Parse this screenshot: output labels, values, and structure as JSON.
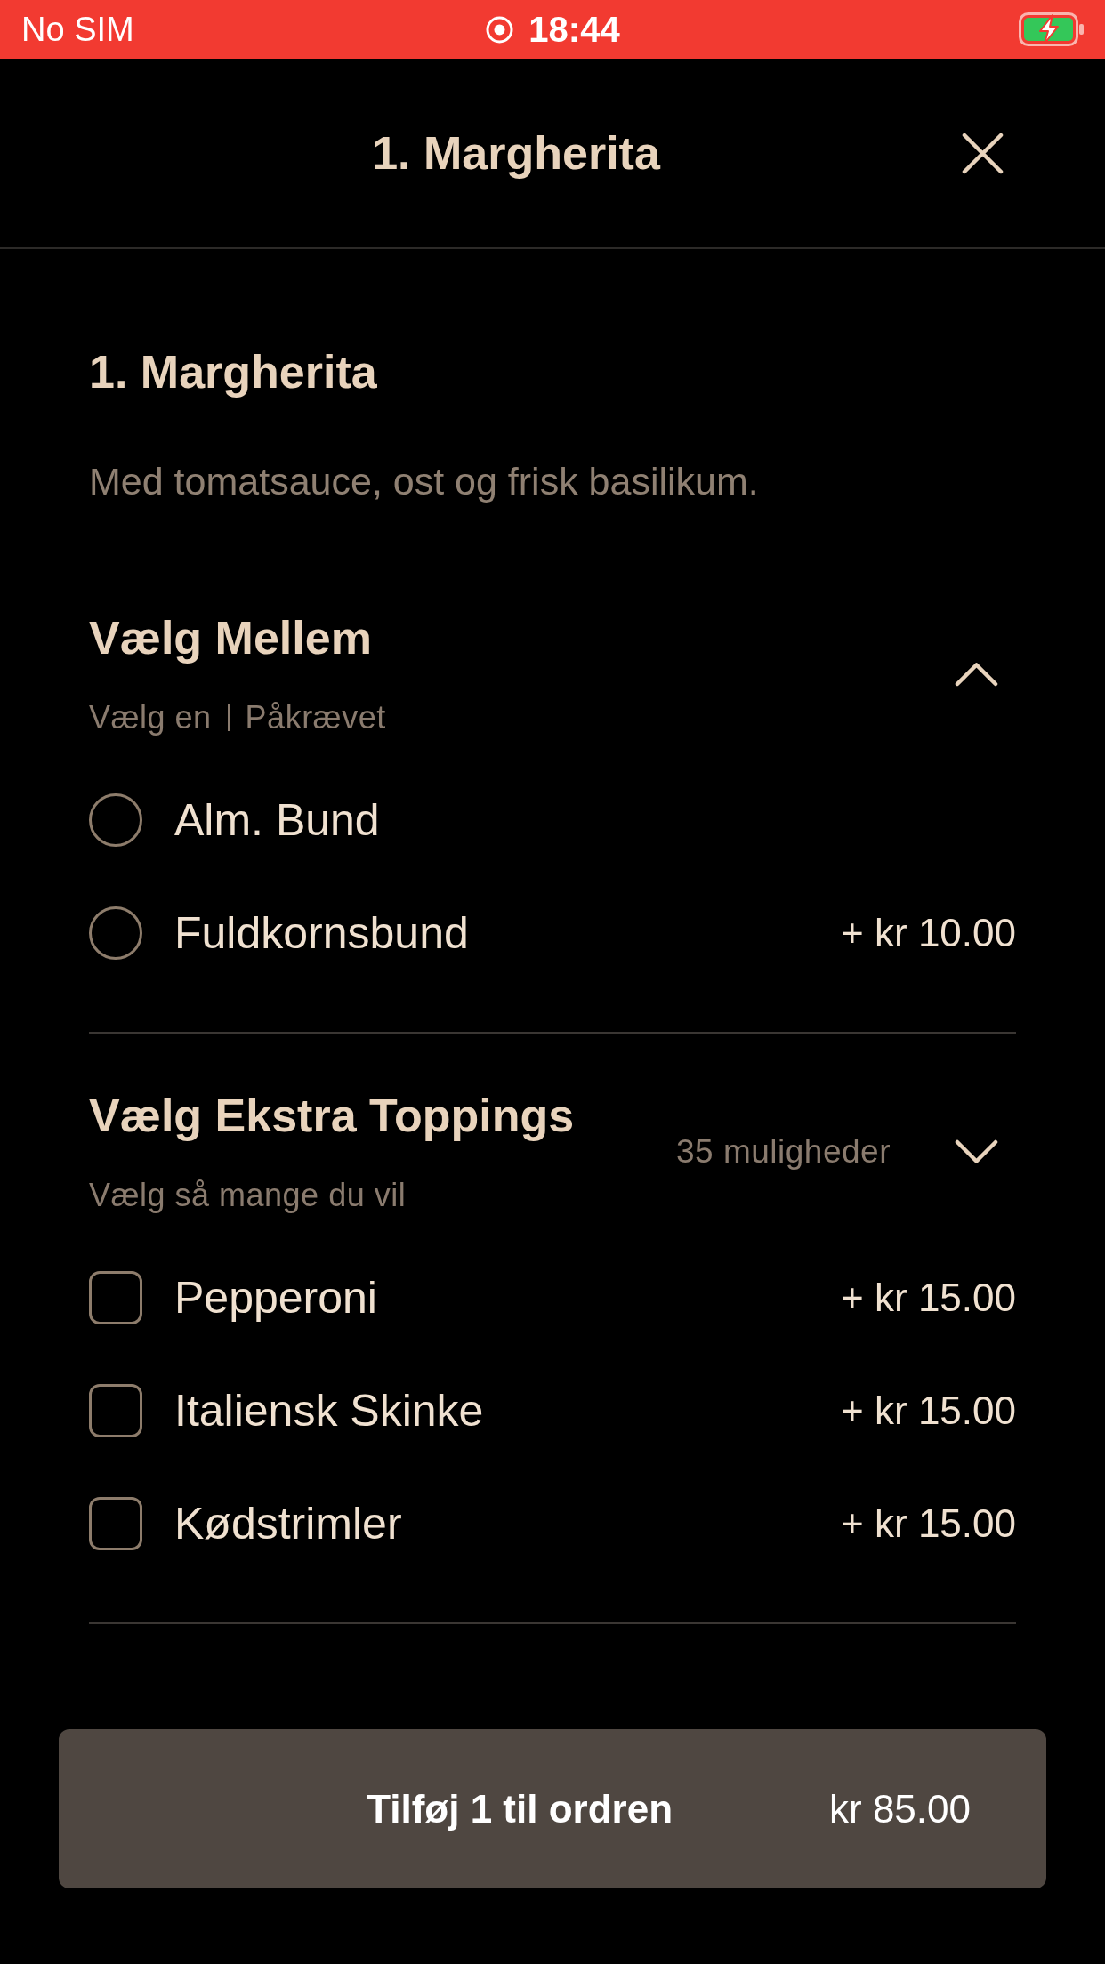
{
  "status_bar": {
    "carrier": "No SIM",
    "time": "18:44"
  },
  "header": {
    "title": "1. Margherita"
  },
  "product": {
    "name": "1. Margherita",
    "description": "Med tomatsauce, ost og frisk basilikum."
  },
  "option_groups": [
    {
      "title": "Vælg Mellem",
      "rules": [
        "Vælg en",
        "Påkrævet"
      ],
      "expanded": true,
      "kind": "radio",
      "options": [
        {
          "label": "Alm. Bund",
          "selected": false
        },
        {
          "label": "Fuldkornsbund",
          "price": "+ kr 10.00",
          "selected": false
        }
      ]
    },
    {
      "title": "Vælg Ekstra Toppings",
      "rules": [
        "Vælg så mange du vil"
      ],
      "count": "35 muligheder",
      "expanded": false,
      "kind": "checkbox",
      "options": [
        {
          "label": "Pepperoni",
          "price": "+ kr 15.00",
          "checked": false
        },
        {
          "label": "Italiensk Skinke",
          "price": "+ kr 15.00",
          "checked": false
        },
        {
          "label": "Kødstrimler",
          "price": "+ kr 15.00",
          "checked": false
        }
      ]
    }
  ],
  "add_button": {
    "label": "Tilføj 1 til ordren",
    "price": "kr 85.00"
  }
}
